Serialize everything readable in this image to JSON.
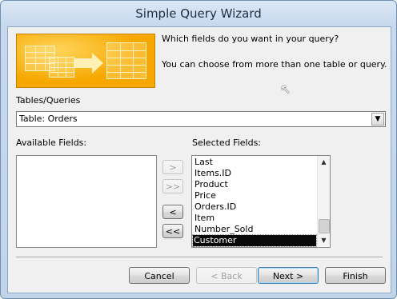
{
  "window": {
    "title": "Simple Query Wizard"
  },
  "intro": {
    "question": "Which fields do you want in your query?",
    "note": "You can choose from more than one table or query."
  },
  "tables_queries": {
    "label": "Tables/Queries",
    "selected": "Table: Orders"
  },
  "available_fields": {
    "label": "Available Fields:",
    "items": []
  },
  "selected_fields": {
    "label": "Selected Fields:",
    "items": [
      "Last",
      "Items.ID",
      "Product",
      "Price",
      "Orders.ID",
      "Item",
      "Number_Sold",
      "Customer"
    ],
    "selected_item": "Customer"
  },
  "move_buttons": {
    "add_one": ">",
    "add_all": ">>",
    "remove_one": "<",
    "remove_all": "<<"
  },
  "footer": {
    "cancel": "Cancel",
    "back": "< Back",
    "next": "Next >",
    "finish": "Finish"
  },
  "colors": {
    "banner": "#f6a800",
    "selection": "#0a0a0a"
  },
  "icons": {
    "banner": "tables-to-query-graphic",
    "cursor": "mouse-pointer-icon"
  }
}
